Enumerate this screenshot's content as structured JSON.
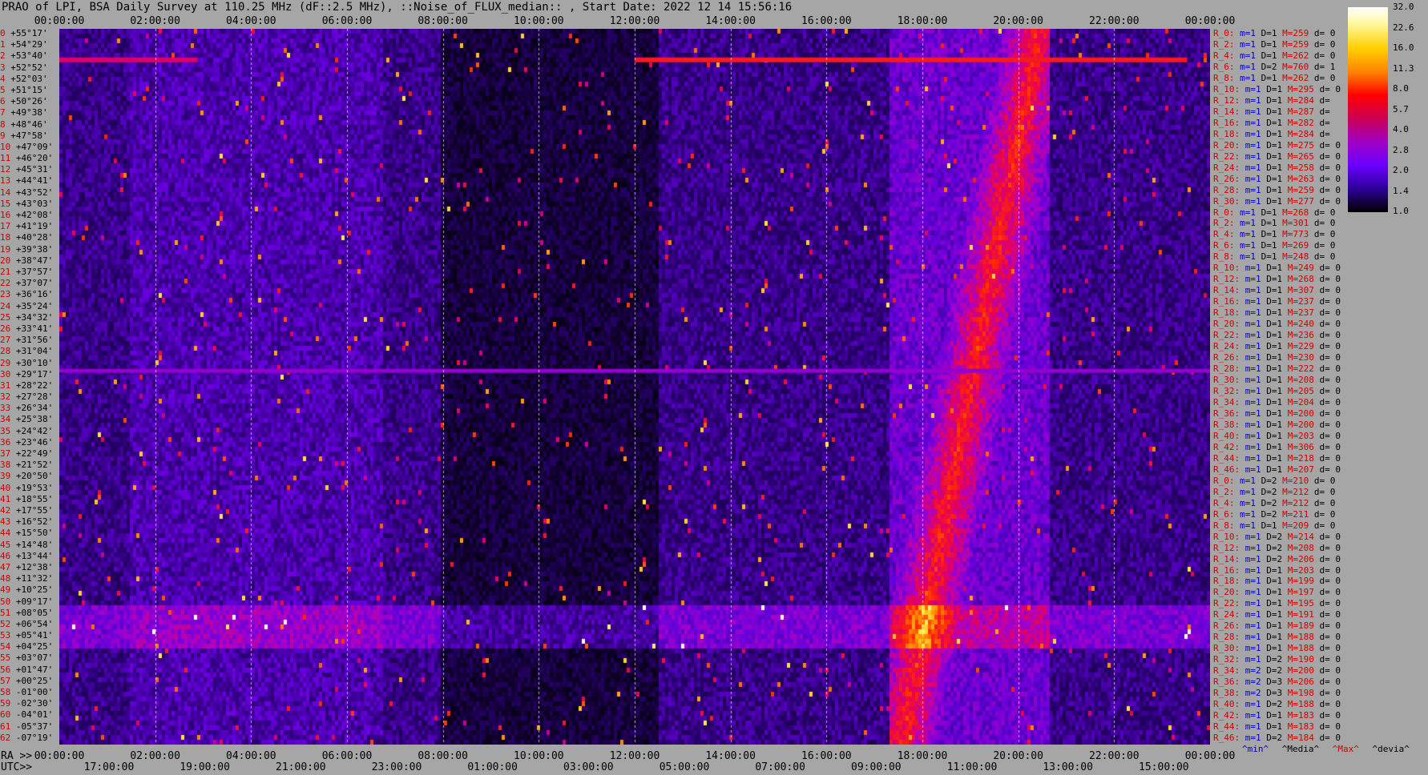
{
  "title": "PRAO of LPI, BSA Daily Survey at 110.25 MHz (dF::2.5 MHz), ::Noise_of_FLUX_median:: , Start Date: 2022 12 14 15:56:16",
  "top_axis": [
    "00:00:00",
    "02:00:00",
    "04:00:00",
    "06:00:00",
    "08:00:00",
    "10:00:00",
    "12:00:00",
    "14:00:00",
    "16:00:00",
    "18:00:00",
    "20:00:00",
    "22:00:00",
    "00:00:00"
  ],
  "bottom_axis_ra_prefix": "RA >>",
  "bottom_axis_ra": [
    "00:00:00",
    "02:00:00",
    "04:00:00",
    "06:00:00",
    "08:00:00",
    "10:00:00",
    "12:00:00",
    "14:00:00",
    "16:00:00",
    "18:00:00",
    "20:00:00",
    "22:00:00",
    "00:00:00"
  ],
  "bottom_axis_utc_prefix": "UTC>>",
  "bottom_axis_utc": [
    "17:00:00",
    "19:00:00",
    "21:00:00",
    "23:00:00",
    "01:00:00",
    "03:00:00",
    "05:00:00",
    "07:00:00",
    "09:00:00",
    "11:00:00",
    "13:00:00",
    "15:00:00"
  ],
  "declinations": [
    {
      "i": "0",
      "d": "+55°17'"
    },
    {
      "i": "1",
      "d": "+54°29'"
    },
    {
      "i": "2",
      "d": "+53°40'"
    },
    {
      "i": "3",
      "d": "+52°52'"
    },
    {
      "i": "4",
      "d": "+52°03'"
    },
    {
      "i": "5",
      "d": "+51°15'"
    },
    {
      "i": "6",
      "d": "+50°26'"
    },
    {
      "i": "7",
      "d": "+49°38'"
    },
    {
      "i": "8",
      "d": "+48°46'"
    },
    {
      "i": "9",
      "d": "+47°58'"
    },
    {
      "i": "10",
      "d": "+47°09'"
    },
    {
      "i": "11",
      "d": "+46°20'"
    },
    {
      "i": "12",
      "d": "+45°31'"
    },
    {
      "i": "13",
      "d": "+44°41'"
    },
    {
      "i": "14",
      "d": "+43°52'"
    },
    {
      "i": "15",
      "d": "+43°03'"
    },
    {
      "i": "16",
      "d": "+42°08'"
    },
    {
      "i": "17",
      "d": "+41°19'"
    },
    {
      "i": "18",
      "d": "+40°28'"
    },
    {
      "i": "19",
      "d": "+39°38'"
    },
    {
      "i": "20",
      "d": "+38°47'"
    },
    {
      "i": "21",
      "d": "+37°57'"
    },
    {
      "i": "22",
      "d": "+37°07'"
    },
    {
      "i": "23",
      "d": "+36°16'"
    },
    {
      "i": "24",
      "d": "+35°24'"
    },
    {
      "i": "25",
      "d": "+34°32'"
    },
    {
      "i": "26",
      "d": "+33°41'"
    },
    {
      "i": "27",
      "d": "+31°56'"
    },
    {
      "i": "28",
      "d": "+31°04'"
    },
    {
      "i": "29",
      "d": "+30°10'"
    },
    {
      "i": "30",
      "d": "+29°17'"
    },
    {
      "i": "31",
      "d": "+28°22'"
    },
    {
      "i": "32",
      "d": "+27°28'"
    },
    {
      "i": "33",
      "d": "+26°34'"
    },
    {
      "i": "34",
      "d": "+25°38'"
    },
    {
      "i": "35",
      "d": "+24°42'"
    },
    {
      "i": "36",
      "d": "+23°46'"
    },
    {
      "i": "37",
      "d": "+22°49'"
    },
    {
      "i": "38",
      "d": "+21°52'"
    },
    {
      "i": "39",
      "d": "+20°50'"
    },
    {
      "i": "40",
      "d": "+19°53'"
    },
    {
      "i": "41",
      "d": "+18°55'"
    },
    {
      "i": "42",
      "d": "+17°55'"
    },
    {
      "i": "43",
      "d": "+16°52'"
    },
    {
      "i": "44",
      "d": "+15°50'"
    },
    {
      "i": "45",
      "d": "+14°48'"
    },
    {
      "i": "46",
      "d": "+13°44'"
    },
    {
      "i": "47",
      "d": "+12°38'"
    },
    {
      "i": "48",
      "d": "+11°32'"
    },
    {
      "i": "49",
      "d": "+10°25'"
    },
    {
      "i": "50",
      "d": "+09°17'"
    },
    {
      "i": "51",
      "d": "+08°05'"
    },
    {
      "i": "52",
      "d": "+06°54'"
    },
    {
      "i": "53",
      "d": "+05°41'"
    },
    {
      "i": "54",
      "d": "+04°25'"
    },
    {
      "i": "55",
      "d": "+03°07'"
    },
    {
      "i": "56",
      "d": "+01°47'"
    },
    {
      "i": "57",
      "d": "+00°25'"
    },
    {
      "i": "58",
      "d": "-01°00'"
    },
    {
      "i": "59",
      "d": "-02°30'"
    },
    {
      "i": "60",
      "d": "-04°01'"
    },
    {
      "i": "61",
      "d": "-05°37'"
    },
    {
      "i": "62",
      "d": "-07°19'"
    }
  ],
  "beams": [
    {
      "n": "R_0:",
      "m": "m=1",
      "D": "D=1",
      "M": "M=259",
      "d": "d= 0"
    },
    {
      "n": "R_2:",
      "m": "m=1",
      "D": "D=1",
      "M": "M=259",
      "d": "d= 0"
    },
    {
      "n": "R_4:",
      "m": "m=1",
      "D": "D=1",
      "M": "M=262",
      "d": "d= 0"
    },
    {
      "n": "R_6:",
      "m": "m=1",
      "D": "D=2",
      "M": "M=760",
      "d": "d= 1"
    },
    {
      "n": "R_8:",
      "m": "m=1",
      "D": "D=1",
      "M": "M=262",
      "d": "d= 0"
    },
    {
      "n": "R_10:",
      "m": "m=1",
      "D": "D=1",
      "M": "M=295",
      "d": "d= 0"
    },
    {
      "n": "R_12:",
      "m": "m=1",
      "D": "D=1",
      "M": "M=284",
      "d": "d="
    },
    {
      "n": "R_14:",
      "m": "m=1",
      "D": "D=1",
      "M": "M=287",
      "d": "d="
    },
    {
      "n": "R_16:",
      "m": "m=1",
      "D": "D=1",
      "M": "M=282",
      "d": "d="
    },
    {
      "n": "R_18:",
      "m": "m=1",
      "D": "D=1",
      "M": "M=284",
      "d": "d="
    },
    {
      "n": "R_20:",
      "m": "m=1",
      "D": "D=1",
      "M": "M=275",
      "d": "d= 0"
    },
    {
      "n": "R_22:",
      "m": "m=1",
      "D": "D=1",
      "M": "M=265",
      "d": "d= 0"
    },
    {
      "n": "R_24:",
      "m": "m=1",
      "D": "D=1",
      "M": "M=258",
      "d": "d= 0"
    },
    {
      "n": "R_26:",
      "m": "m=1",
      "D": "D=1",
      "M": "M=263",
      "d": "d= 0"
    },
    {
      "n": "R_28:",
      "m": "m=1",
      "D": "D=1",
      "M": "M=259",
      "d": "d= 0"
    },
    {
      "n": "R_30:",
      "m": "m=1",
      "D": "D=1",
      "M": "M=277",
      "d": "d= 0"
    },
    {
      "n": "R_0:",
      "m": "m=1",
      "D": "D=1",
      "M": "M=268",
      "d": "d= 0"
    },
    {
      "n": "R_2:",
      "m": "m=1",
      "D": "D=1",
      "M": "M=301",
      "d": "d= 0"
    },
    {
      "n": "R_4:",
      "m": "m=1",
      "D": "D=1",
      "M": "M=773",
      "d": "d= 0"
    },
    {
      "n": "R_6:",
      "m": "m=1",
      "D": "D=1",
      "M": "M=269",
      "d": "d= 0"
    },
    {
      "n": "R_8:",
      "m": "m=1",
      "D": "D=1",
      "M": "M=248",
      "d": "d= 0"
    },
    {
      "n": "R_10:",
      "m": "m=1",
      "D": "D=1",
      "M": "M=249",
      "d": "d= 0"
    },
    {
      "n": "R_12:",
      "m": "m=1",
      "D": "D=1",
      "M": "M=268",
      "d": "d= 0"
    },
    {
      "n": "R_14:",
      "m": "m=1",
      "D": "D=1",
      "M": "M=307",
      "d": "d= 0"
    },
    {
      "n": "R_16:",
      "m": "m=1",
      "D": "D=1",
      "M": "M=237",
      "d": "d= 0"
    },
    {
      "n": "R_18:",
      "m": "m=1",
      "D": "D=1",
      "M": "M=237",
      "d": "d= 0"
    },
    {
      "n": "R_20:",
      "m": "m=1",
      "D": "D=1",
      "M": "M=240",
      "d": "d= 0"
    },
    {
      "n": "R_22:",
      "m": "m=1",
      "D": "D=1",
      "M": "M=236",
      "d": "d= 0"
    },
    {
      "n": "R_24:",
      "m": "m=1",
      "D": "D=1",
      "M": "M=229",
      "d": "d= 0"
    },
    {
      "n": "R_26:",
      "m": "m=1",
      "D": "D=1",
      "M": "M=230",
      "d": "d= 0"
    },
    {
      "n": "R_28:",
      "m": "m=1",
      "D": "D=1",
      "M": "M=222",
      "d": "d= 0"
    },
    {
      "n": "R_30:",
      "m": "m=1",
      "D": "D=1",
      "M": "M=208",
      "d": "d= 0"
    },
    {
      "n": "R_32:",
      "m": "m=1",
      "D": "D=1",
      "M": "M=205",
      "d": "d= 0"
    },
    {
      "n": "R_34:",
      "m": "m=1",
      "D": "D=1",
      "M": "M=204",
      "d": "d= 0"
    },
    {
      "n": "R_36:",
      "m": "m=1",
      "D": "D=1",
      "M": "M=200",
      "d": "d= 0"
    },
    {
      "n": "R_38:",
      "m": "m=1",
      "D": "D=1",
      "M": "M=200",
      "d": "d= 0"
    },
    {
      "n": "R_40:",
      "m": "m=1",
      "D": "D=1",
      "M": "M=203",
      "d": "d= 0"
    },
    {
      "n": "R_42:",
      "m": "m=1",
      "D": "D=1",
      "M": "M=306",
      "d": "d= 0"
    },
    {
      "n": "R_44:",
      "m": "m=1",
      "D": "D=1",
      "M": "M=218",
      "d": "d= 0"
    },
    {
      "n": "R_46:",
      "m": "m=1",
      "D": "D=1",
      "M": "M=207",
      "d": "d= 0"
    },
    {
      "n": "R_0:",
      "m": "m=1",
      "D": "D=2",
      "M": "M=210",
      "d": "d= 0"
    },
    {
      "n": "R_2:",
      "m": "m=1",
      "D": "D=2",
      "M": "M=212",
      "d": "d= 0"
    },
    {
      "n": "R_4:",
      "m": "m=1",
      "D": "D=2",
      "M": "M=212",
      "d": "d= 0"
    },
    {
      "n": "R_6:",
      "m": "m=1",
      "D": "D=2",
      "M": "M=211",
      "d": "d= 0"
    },
    {
      "n": "R_8:",
      "m": "m=1",
      "D": "D=1",
      "M": "M=209",
      "d": "d= 0"
    },
    {
      "n": "R_10:",
      "m": "m=1",
      "D": "D=2",
      "M": "M=214",
      "d": "d= 0"
    },
    {
      "n": "R_12:",
      "m": "m=1",
      "D": "D=2",
      "M": "M=208",
      "d": "d= 0"
    },
    {
      "n": "R_14:",
      "m": "m=1",
      "D": "D=2",
      "M": "M=206",
      "d": "d= 0"
    },
    {
      "n": "R_16:",
      "m": "m=1",
      "D": "D=1",
      "M": "M=203",
      "d": "d= 0"
    },
    {
      "n": "R_18:",
      "m": "m=1",
      "D": "D=1",
      "M": "M=199",
      "d": "d= 0"
    },
    {
      "n": "R_20:",
      "m": "m=1",
      "D": "D=1",
      "M": "M=197",
      "d": "d= 0"
    },
    {
      "n": "R_22:",
      "m": "m=1",
      "D": "D=1",
      "M": "M=195",
      "d": "d= 0"
    },
    {
      "n": "R_24:",
      "m": "m=1",
      "D": "D=1",
      "M": "M=191",
      "d": "d= 0"
    },
    {
      "n": "R_26:",
      "m": "m=1",
      "D": "D=1",
      "M": "M=189",
      "d": "d= 0"
    },
    {
      "n": "R_28:",
      "m": "m=1",
      "D": "D=1",
      "M": "M=188",
      "d": "d= 0"
    },
    {
      "n": "R_30:",
      "m": "m=1",
      "D": "D=1",
      "M": "M=188",
      "d": "d= 0"
    },
    {
      "n": "R_32:",
      "m": "m=1",
      "D": "D=2",
      "M": "M=190",
      "d": "d= 0"
    },
    {
      "n": "R_34:",
      "m": "m=2",
      "D": "D=2",
      "M": "M=200",
      "d": "d= 0"
    },
    {
      "n": "R_36:",
      "m": "m=2",
      "D": "D=3",
      "M": "M=206",
      "d": "d= 0"
    },
    {
      "n": "R_38:",
      "m": "m=2",
      "D": "D=3",
      "M": "M=198",
      "d": "d= 0"
    },
    {
      "n": "R_40:",
      "m": "m=1",
      "D": "D=2",
      "M": "M=188",
      "d": "d= 0"
    },
    {
      "n": "R_42:",
      "m": "m=1",
      "D": "D=1",
      "M": "M=183",
      "d": "d= 0"
    },
    {
      "n": "R_44:",
      "m": "m=1",
      "D": "D=1",
      "M": "M=183",
      "d": "d= 0"
    },
    {
      "n": "R_46:",
      "m": "m=1",
      "D": "D=2",
      "M": "M=184",
      "d": "d= 0"
    }
  ],
  "colorbar_ticks": [
    "32.0",
    "22.6",
    "16.0",
    "11.3",
    "8.0",
    "5.7",
    "4.0",
    "2.8",
    "2.0",
    "1.4",
    "1.0"
  ],
  "footer_stats": {
    "min": "^min^",
    "media": "^Media^",
    "max": "^Max^",
    "devia": "^devia^"
  },
  "colors": {
    "background": "#a6a6a6",
    "low": "#140028",
    "mid": "#6a00ff",
    "high": "#ff2000",
    "peak": "#ffffff"
  }
}
